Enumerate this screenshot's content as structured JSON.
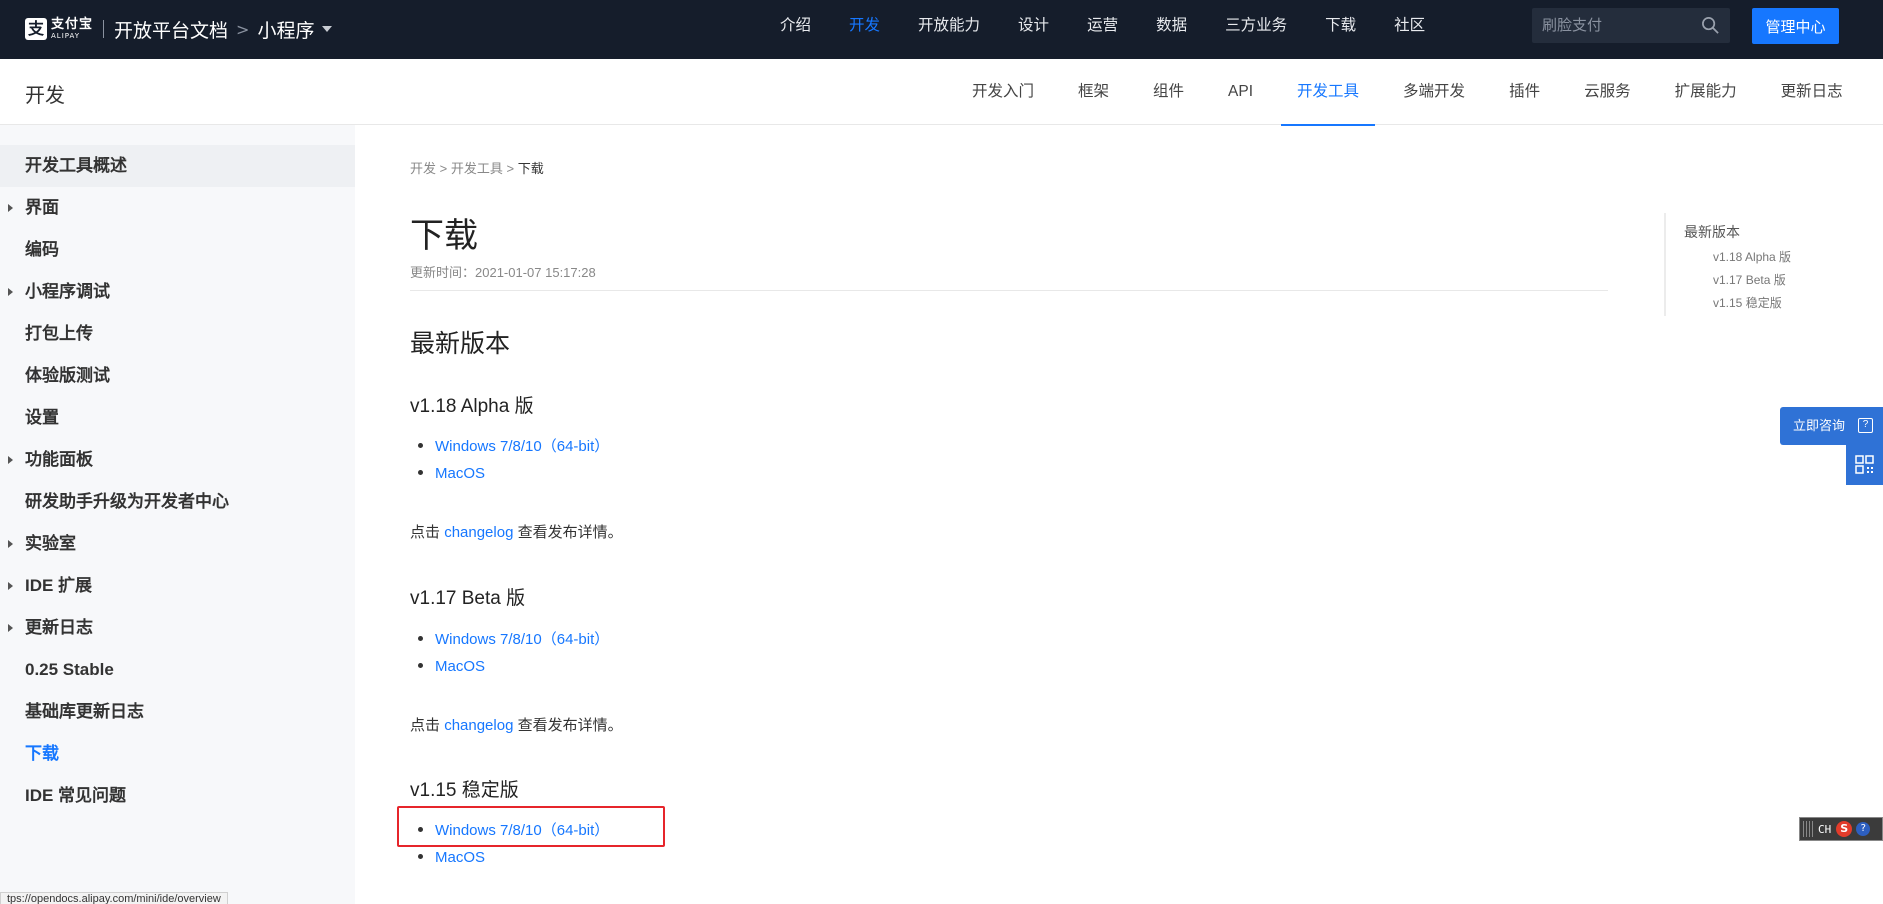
{
  "topbar": {
    "logo_cn": "支付宝",
    "logo_en": "ALIPAY",
    "logo_mark": "支",
    "doc_title": "开放平台文档",
    "crumb_sep": ">",
    "mini_title": "小程序",
    "nav": [
      {
        "label": "介绍",
        "active": false
      },
      {
        "label": "开发",
        "active": true
      },
      {
        "label": "开放能力",
        "active": false
      },
      {
        "label": "设计",
        "active": false
      },
      {
        "label": "运营",
        "active": false
      },
      {
        "label": "数据",
        "active": false
      },
      {
        "label": "三方业务",
        "active": false
      },
      {
        "label": "下载",
        "active": false
      },
      {
        "label": "社区",
        "active": false
      }
    ],
    "search_placeholder": "刷脸支付",
    "admin_label": "管理中心"
  },
  "subbar": {
    "section": "开发",
    "nav": [
      {
        "label": "开发入门",
        "active": false
      },
      {
        "label": "框架",
        "active": false
      },
      {
        "label": "组件",
        "active": false
      },
      {
        "label": "API",
        "active": false
      },
      {
        "label": "开发工具",
        "active": true
      },
      {
        "label": "多端开发",
        "active": false
      },
      {
        "label": "插件",
        "active": false
      },
      {
        "label": "云服务",
        "active": false
      },
      {
        "label": "扩展能力",
        "active": false
      },
      {
        "label": "更新日志",
        "active": false
      }
    ]
  },
  "sidebar": {
    "items": [
      {
        "label": "开发工具概述",
        "expandable": false,
        "active": false
      },
      {
        "label": "界面",
        "expandable": true,
        "active": false
      },
      {
        "label": "编码",
        "expandable": false,
        "active": false
      },
      {
        "label": "小程序调试",
        "expandable": true,
        "active": false
      },
      {
        "label": "打包上传",
        "expandable": false,
        "active": false
      },
      {
        "label": "体验版测试",
        "expandable": false,
        "active": false
      },
      {
        "label": "设置",
        "expandable": false,
        "active": false
      },
      {
        "label": "功能面板",
        "expandable": true,
        "active": false
      },
      {
        "label": "研发助手升级为开发者中心",
        "expandable": false,
        "active": false
      },
      {
        "label": "实验室",
        "expandable": true,
        "active": false
      },
      {
        "label": "IDE 扩展",
        "expandable": true,
        "active": false
      },
      {
        "label": "更新日志",
        "expandable": true,
        "active": false
      },
      {
        "label": "0.25 Stable",
        "expandable": false,
        "active": false
      },
      {
        "label": "基础库更新日志",
        "expandable": false,
        "active": false
      },
      {
        "label": "下载",
        "expandable": false,
        "active": true
      },
      {
        "label": "IDE 常见问题",
        "expandable": false,
        "active": false
      }
    ],
    "status_url": "tps://opendocs.alipay.com/mini/ide/overview"
  },
  "content": {
    "breadcrumb": {
      "a": "开发",
      "b": "开发工具",
      "current": "下载",
      "sep": ">"
    },
    "title": "下载",
    "updated": "更新时间：2021-01-07 15:17:28",
    "section_title": "最新版本",
    "versions": [
      {
        "title": "v1.18 Alpha 版",
        "windows": "Windows 7/8/10（64-bit）",
        "mac": "MacOS",
        "note_pre": "点击",
        "note_link": "changelog",
        "note_post": "查看发布详情。"
      },
      {
        "title": "v1.17 Beta 版",
        "windows": "Windows 7/8/10（64-bit）",
        "mac": "MacOS",
        "note_pre": "点击",
        "note_link": "changelog",
        "note_post": "查看发布详情。"
      },
      {
        "title": "v1.15 稳定版",
        "windows": "Windows 7/8/10（64-bit）",
        "mac": "MacOS"
      }
    ]
  },
  "toc": {
    "head": "最新版本",
    "items": [
      "v1.18 Alpha 版",
      "v1.17 Beta 版",
      "v1.15 稳定版"
    ]
  },
  "float": {
    "consult_label": "立即咨询",
    "consult_q": "?"
  },
  "ime": {
    "ch": "CH",
    "s": "S",
    "help": "?"
  },
  "colors": {
    "accent": "#1677ff",
    "topbar_bg": "#151d2b",
    "highlight": "#e6252b"
  }
}
